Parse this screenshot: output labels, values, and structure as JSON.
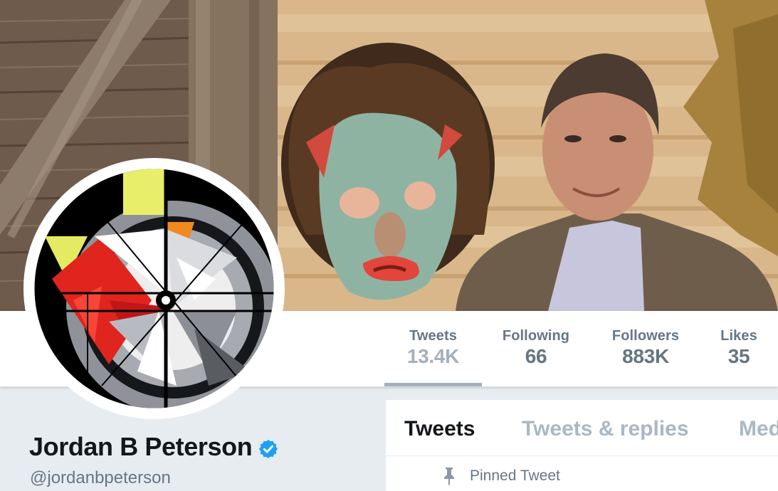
{
  "profile": {
    "name": "Jordan B Peterson",
    "handle": "@jordanbpeterson",
    "verified": true
  },
  "stats": [
    {
      "label": "Tweets",
      "value": "13.4K",
      "active": true
    },
    {
      "label": "Following",
      "value": "66",
      "active": false
    },
    {
      "label": "Followers",
      "value": "883K",
      "active": false
    },
    {
      "label": "Likes",
      "value": "35",
      "active": false
    }
  ],
  "tabs": [
    {
      "label": "Tweets",
      "active": true
    },
    {
      "label": "Tweets & replies",
      "active": false
    },
    {
      "label": "Media",
      "active": false
    }
  ],
  "pinned": {
    "label": "Pinned Tweet",
    "icon": "pin-icon"
  },
  "icons": {
    "verified": "verified-badge-icon"
  },
  "colors": {
    "verified": "#1da1f2",
    "text_primary": "#14171a",
    "text_secondary": "#657786",
    "inactive_tab": "#aab8c2",
    "page_bg": "#e6ecf0"
  }
}
